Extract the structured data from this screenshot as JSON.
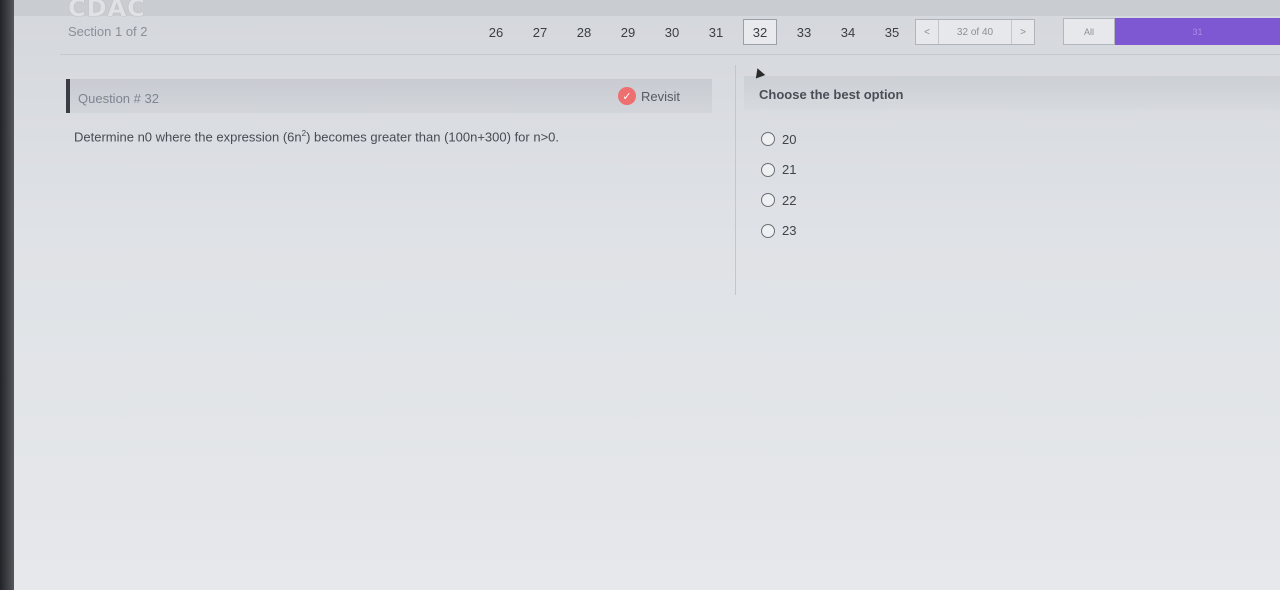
{
  "app": {
    "logo_text": "CDAC"
  },
  "header": {
    "section_label": "Section 1 of 2",
    "question_nav": [
      "26",
      "27",
      "28",
      "29",
      "30",
      "31",
      "32",
      "33",
      "34",
      "35"
    ],
    "current_question": "32",
    "pager": {
      "prev": "<",
      "text": "32 of 40",
      "next": ">"
    },
    "filter_label": "All",
    "progress_label": "31",
    "progress_color": "#7e57d2"
  },
  "question": {
    "title": "Question # 32",
    "revisit_label": "Revisit",
    "text_before": "Determine n0 where the expression (6n",
    "text_sup": "2",
    "text_after": ") becomes greater than (100n+300) for n>0."
  },
  "options_panel": {
    "title": "Choose the best option",
    "options": [
      "20",
      "21",
      "22",
      "23"
    ]
  }
}
